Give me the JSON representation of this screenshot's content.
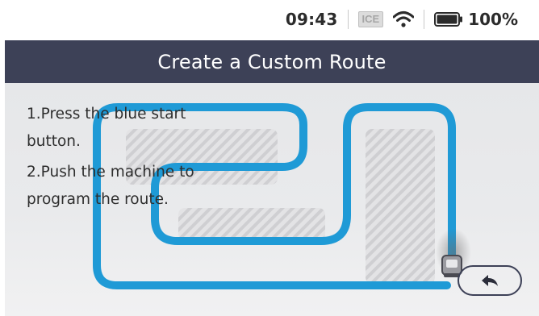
{
  "status_bar": {
    "time": "09:43",
    "ice_label": "ICE",
    "battery_percent": "100%",
    "battery_level": 1.0,
    "wifi_icon": "wifi-icon",
    "battery_icon": "battery-icon"
  },
  "header": {
    "title": "Create a Custom Route"
  },
  "instructions": {
    "step1": "1.Press the blue start button.",
    "step2": "2.Push the machine to program the route."
  },
  "actions": {
    "back_icon": "back-arrow-icon"
  },
  "colors": {
    "title_bar": "#3d4157",
    "route_line": "#1f9ad6",
    "obstacle_hatch": "#c8c8c8"
  }
}
